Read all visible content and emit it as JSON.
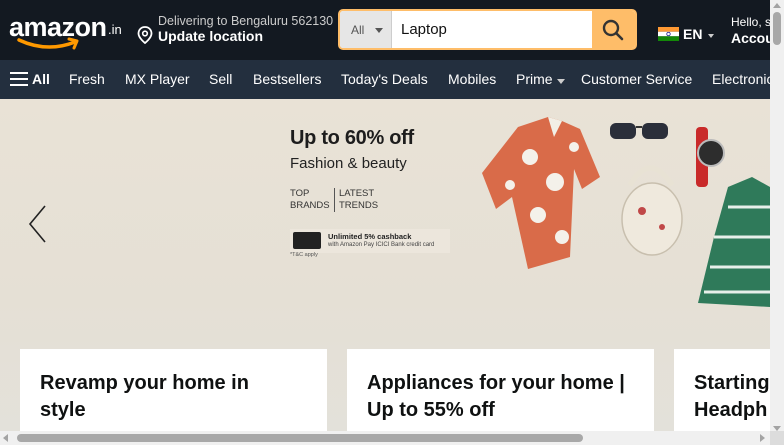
{
  "header": {
    "logo_text": "amazon",
    "logo_tld": ".in",
    "delivery": {
      "line1": "Delivering to Bengaluru 562130",
      "line2": "Update location"
    },
    "search": {
      "category": "All",
      "value": "Laptop",
      "icon": "search-icon"
    },
    "language": {
      "code": "EN",
      "flag": "india-flag-icon"
    },
    "account": {
      "line1": "Hello, s",
      "line2": "Accou"
    }
  },
  "nav": {
    "all_label": "All",
    "items": [
      "Fresh",
      "MX Player",
      "Sell",
      "Bestsellers",
      "Today's Deals",
      "Mobiles",
      "Prime",
      "Customer Service",
      "Electronic"
    ]
  },
  "hero": {
    "headline": "Up to 60% off",
    "subheadline": "Fashion & beauty",
    "tag_left": "TOP BRANDS",
    "tag_right": "LATEST TRENDS",
    "cashback_title": "Unlimited 5% cashback",
    "cashback_sub": "with Amazon Pay ICICI Bank credit card",
    "fine_print": "*T&C apply"
  },
  "cards": [
    {
      "title": "Revamp your home in style"
    },
    {
      "title": "Appliances for your home | Up to 55% off"
    },
    {
      "title": "Starting Headph"
    }
  ],
  "colors": {
    "header_bg": "#131921",
    "nav_bg": "#232f3e",
    "search_button": "#febd69",
    "logo_smile": "#ff9900"
  }
}
